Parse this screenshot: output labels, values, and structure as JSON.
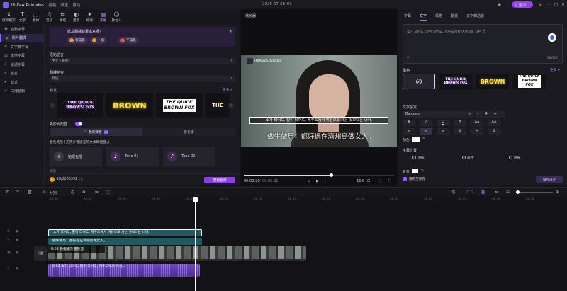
{
  "app": {
    "name": "HitPaw Edimakor",
    "menu": [
      "檔案",
      "設定",
      "幫助"
    ],
    "doc_name": "2025-07-28_01",
    "export_label": "匯出"
  },
  "toolbar": [
    {
      "label": "匯師檔案",
      "icon": "⬇"
    },
    {
      "label": "文字",
      "icon": "T"
    },
    {
      "label": "素材",
      "icon": "⬚"
    },
    {
      "label": "音訊",
      "icon": "♫"
    },
    {
      "label": "轉場",
      "icon": "⇆"
    },
    {
      "label": "濾鏡",
      "icon": "◐"
    },
    {
      "label": "特效",
      "icon": "✦"
    },
    {
      "label": "字幕",
      "icon": "▤"
    },
    {
      "label": "數位人",
      "icon": "☺"
    }
  ],
  "toolbar_active": 7,
  "leftnav": [
    {
      "label": "自動字幕",
      "icon": "▣"
    },
    {
      "label": "影片翻譯",
      "icon": "◈"
    },
    {
      "label": "文字轉字幕",
      "icon": "≡"
    },
    {
      "label": "本地字幕",
      "icon": "▤"
    },
    {
      "label": "歌詞字幕",
      "icon": "♪"
    },
    {
      "label": "自訂",
      "icon": "✎"
    },
    {
      "label": "樣式",
      "icon": "▾"
    },
    {
      "label": "口播剪輯",
      "icon": "✂"
    }
  ],
  "leftnav_active": 1,
  "feedback": {
    "question": "此次翻譯結果滿意嗎？",
    "options": [
      "很滿意",
      "一般",
      "不滿意"
    ]
  },
  "source_lang": {
    "label": "原始語言",
    "value": "中文（繁體）"
  },
  "target_lang": {
    "label": "翻譯語言",
    "value": "韓語"
  },
  "style": {
    "label": "樣式",
    "more": "更多 >",
    "cards": [
      "THE QUICK BROWN FOX",
      "BROWN",
      "THE QUICK BROWN FOX",
      "THE"
    ]
  },
  "voiceover": {
    "label": "為影片配音",
    "tabs": [
      "我的聲音",
      "音色庫"
    ],
    "clone_title": "音色克隆 (支持多種語言的文本轉語音。)",
    "voices": [
      "點選克隆",
      "Tone 01",
      "Tone 02"
    ],
    "partial": "音調"
  },
  "credits": "10/2265391",
  "generate_label": "開始翻譯",
  "preview": {
    "title": "播放器",
    "watermark": "HitPaw Edimakor",
    "subtitle_ko": "소가 되어도, 말이 되어도, 제주도에서 여성으로 사는 것보다는 나아.",
    "subtitle_zh": "做牛做馬，都好過在濟州島做女人。",
    "time_current": "00:02:26",
    "time_total": "00:05:01",
    "ratio": "16:9",
    "progress": 0.58
  },
  "rightpanel": {
    "tabs": [
      "字幕",
      "文字",
      "風格",
      "動畫",
      "文字轉語音"
    ],
    "active": 1,
    "text": "소가 되어도, 말이 되어도, 제주도에서 여성으로 사는 것",
    "count": "38/100",
    "style_label": "風格",
    "more": "更多 >",
    "style_cards": [
      "⊘",
      "THE QUICK BROWN FOX",
      "BROWN",
      "THE QUICK BROWN FOX"
    ],
    "text_settings": "文字設定",
    "font": "Bangers",
    "size": "4",
    "format": [
      "B",
      "I",
      "U",
      "T̶",
      "Aa",
      "AA"
    ],
    "color_label": "顏色",
    "position_label": "字幕位置",
    "positions": [
      "頂部",
      "居中",
      "底部"
    ],
    "bg_label": "背景",
    "apply_all": "應用至所有",
    "save": "儲存設定"
  },
  "timeline": {
    "split_label": "分割",
    "ticks": [
      "00:00",
      "00:02",
      "00:04",
      "00:06",
      "00:08",
      "00:10",
      "00:12",
      "00:14",
      "00:16",
      "00:18",
      "00:20",
      "00:22",
      "00:24",
      "00:26",
      "00:28"
    ],
    "track_label": "封面",
    "clip_sub1": "소가 되어도, 말이 되어도, 제주도에서 여성으로 사는 것보다는 나아.",
    "clip_sub2": "做牛做馬，都好過在濟州島做女人。",
    "clip_video": "0:05 我繼續升遷我選",
    "clip_audio": "0:02 소가 되어도, 말이 되어도, 제주도에서 여성..."
  },
  "colors": {
    "accent": "#9a3df2",
    "bg": "#141419"
  }
}
